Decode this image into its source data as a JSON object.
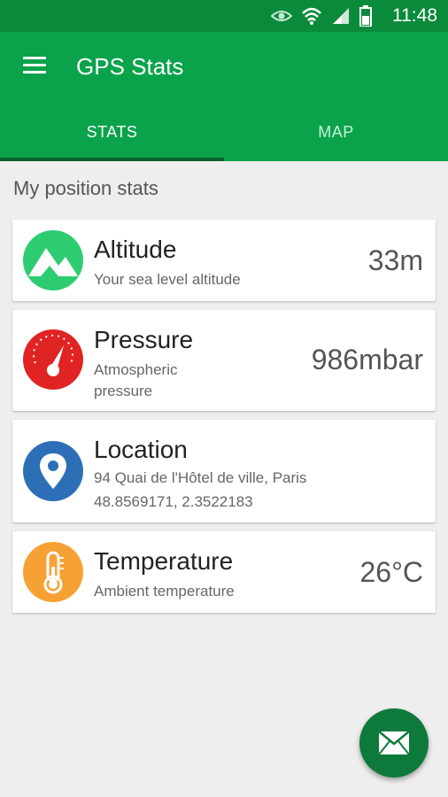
{
  "status_bar": {
    "time": "11:48"
  },
  "app_bar": {
    "title": "GPS Stats"
  },
  "tabs": [
    {
      "label": "STATS",
      "selected": true
    },
    {
      "label": "MAP",
      "selected": false
    }
  ],
  "section_title": "My position stats",
  "cards": {
    "altitude": {
      "title": "Altitude",
      "subtitle": "Your sea level altitude",
      "value": "33m",
      "icon": "mountain-icon",
      "color": "#2ecc71"
    },
    "pressure": {
      "title": "Pressure",
      "subtitle_line1": "Atmospheric",
      "subtitle_line2": "pressure",
      "value": "986mbar",
      "icon": "gauge-icon",
      "color": "#e02424"
    },
    "location": {
      "title": "Location",
      "address": "94 Quai de l'Hôtel de ville, Paris",
      "coords": "48.8569171, 2.3522183",
      "icon": "location-pin-icon",
      "color": "#2d6fb6"
    },
    "temperature": {
      "title": "Temperature",
      "subtitle": "Ambient temperature",
      "value": "26°C",
      "icon": "thermometer-icon",
      "color": "#f7a135"
    }
  },
  "fab": {
    "icon": "mail-icon",
    "color": "#0d7a3b"
  }
}
